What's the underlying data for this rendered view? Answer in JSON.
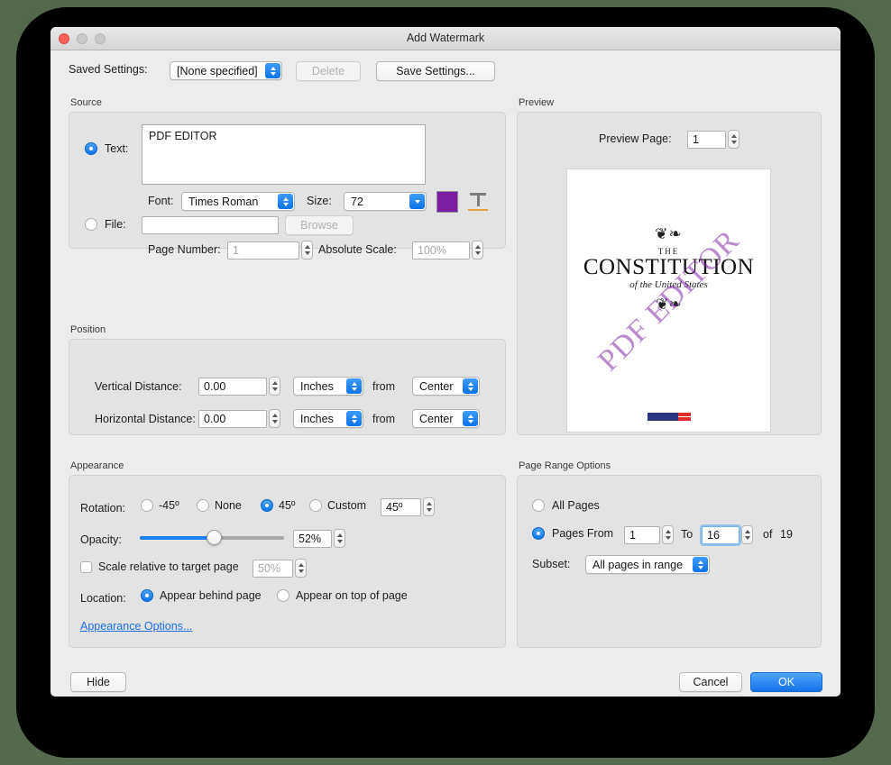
{
  "window": {
    "title": "Add Watermark",
    "traffic_lights": [
      "close-button",
      "minimize-button",
      "maximize-button"
    ]
  },
  "toolbar": {
    "saved_settings_label": "Saved Settings:",
    "saved_settings_value": "[None specified]",
    "delete_label": "Delete",
    "save_settings_label": "Save Settings..."
  },
  "source": {
    "caption": "Source",
    "text_radio_label": "Text:",
    "text_value": "PDF EDITOR",
    "font_label": "Font:",
    "font_value": "Times Roman",
    "size_label": "Size:",
    "size_value": "72",
    "color_swatch": "#7B1FA2",
    "text_style_icon": "text-style-icon",
    "file_radio_label": "File:",
    "file_value": "",
    "browse_label": "Browse",
    "page_number_label": "Page Number:",
    "page_number_value": "1",
    "absolute_scale_label": "Absolute Scale:",
    "absolute_scale_value": "100%"
  },
  "position": {
    "caption": "Position",
    "vertical_label": "Vertical Distance:",
    "vertical_value": "0.00",
    "vertical_unit": "Inches",
    "vertical_from_label": "from",
    "vertical_from": "Center",
    "horizontal_label": "Horizontal Distance:",
    "horizontal_value": "0.00",
    "horizontal_unit": "Inches",
    "horizontal_from_label": "from",
    "horizontal_from": "Center"
  },
  "appearance": {
    "caption": "Appearance",
    "rotation_label": "Rotation:",
    "rotation_neg45": "-45º",
    "rotation_none": "None",
    "rotation_45": "45º",
    "rotation_custom": "Custom",
    "rotation_custom_value": "45º",
    "opacity_label": "Opacity:",
    "opacity_value": "52%",
    "opacity_percent": 52,
    "scale_checkbox_label": "Scale relative to target page",
    "scale_value": "50%",
    "location_label": "Location:",
    "location_behind": "Appear behind page",
    "location_ontop": "Appear on top of page",
    "options_link": "Appearance Options..."
  },
  "preview": {
    "caption": "Preview",
    "page_label": "Preview Page:",
    "page_value": "1",
    "document": {
      "eyebrow": "THE",
      "title": "CONSTITUTION",
      "subtitle": "of the United States",
      "watermark_text": "PDF EDITOR",
      "watermark_color": "#7B1FA2"
    }
  },
  "page_range": {
    "caption": "Page Range Options",
    "all_pages_label": "All Pages",
    "pages_from_label": "Pages From",
    "pages_from_value": "1",
    "to_label": "To",
    "to_value": "16",
    "of_label": "of",
    "total_pages": "19",
    "subset_label": "Subset:",
    "subset_value": "All pages in range"
  },
  "footer": {
    "hide_label": "Hide",
    "cancel_label": "Cancel",
    "ok_label": "OK"
  }
}
